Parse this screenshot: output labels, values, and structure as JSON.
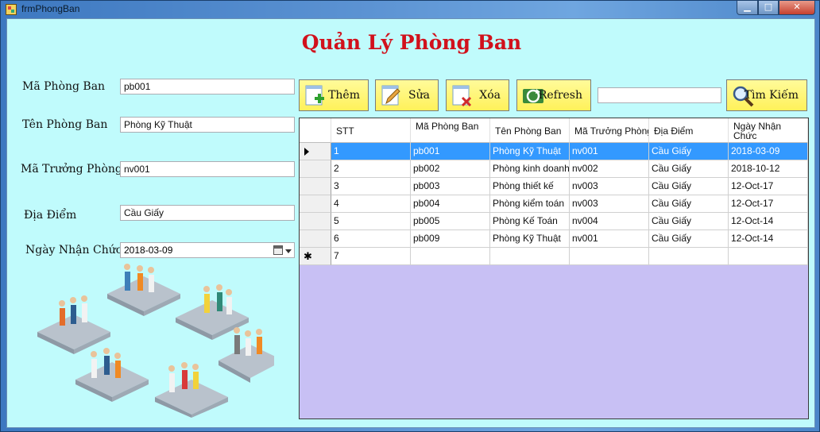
{
  "window": {
    "title": "frmPhongBan",
    "minimize": "▁",
    "maximize": "□",
    "close": "✕"
  },
  "page_title": "Quản Lý Phòng Ban",
  "form": {
    "ma_phong_ban_label": "Mã Phòng Ban",
    "ma_phong_ban_value": "pb001",
    "ten_phong_ban_label": "Tên Phòng Ban",
    "ten_phong_ban_value": "Phòng Kỹ Thuật",
    "ma_truong_phong_label": "Mã Trưởng Phòng",
    "ma_truong_phong_value": "nv001",
    "dia_diem_label": "Địa Điểm",
    "dia_diem_value": "Cầu Giấy",
    "ngay_nhan_chuc_label": "Ngày Nhận Chức",
    "ngay_nhan_chuc_value": "2018-03-09"
  },
  "toolbar": {
    "add_label": "Thêm",
    "edit_label": "Sửa",
    "delete_label": "Xóa",
    "refresh_label": "Refresh",
    "search_value": "",
    "search_label": "Tìm Kiếm"
  },
  "grid": {
    "columns": [
      "STT",
      "Mã Phòng Ban",
      "Tên Phòng Ban",
      "Mã Trưởng Phòng",
      "Địa Điểm",
      "Ngày Nhận Chức"
    ],
    "rows": [
      [
        "1",
        "pb001",
        "Phòng Kỹ Thuật",
        "nv001",
        "Cầu Giấy",
        "2018-03-09"
      ],
      [
        "2",
        "pb002",
        "Phòng kinh doanh",
        "nv002",
        "Cầu Giấy",
        "2018-10-12"
      ],
      [
        "3",
        "pb003",
        "Phòng thiết kế",
        "nv003",
        "Cầu Giấy",
        "12-Oct-17"
      ],
      [
        "4",
        "pb004",
        "Phòng kiểm toán",
        "nv003",
        "Cầu Giấy",
        "12-Oct-17"
      ],
      [
        "5",
        "pb005",
        "Phòng Kế Toán",
        "nv004",
        "Cầu Giấy",
        "12-Oct-14"
      ],
      [
        "6",
        "pb009",
        "Phòng Kỹ Thuật",
        "nv001",
        "Cầu Giấy",
        "12-Oct-14"
      ]
    ],
    "new_row_stt": "7",
    "selected_row": 0
  },
  "colors": {
    "client_bg": "#c0fbfc",
    "title_red": "#d1111c",
    "button_yellow": "#fff15a",
    "selection_blue": "#3399ff",
    "grid_empty_bg": "#c8c0f4"
  }
}
